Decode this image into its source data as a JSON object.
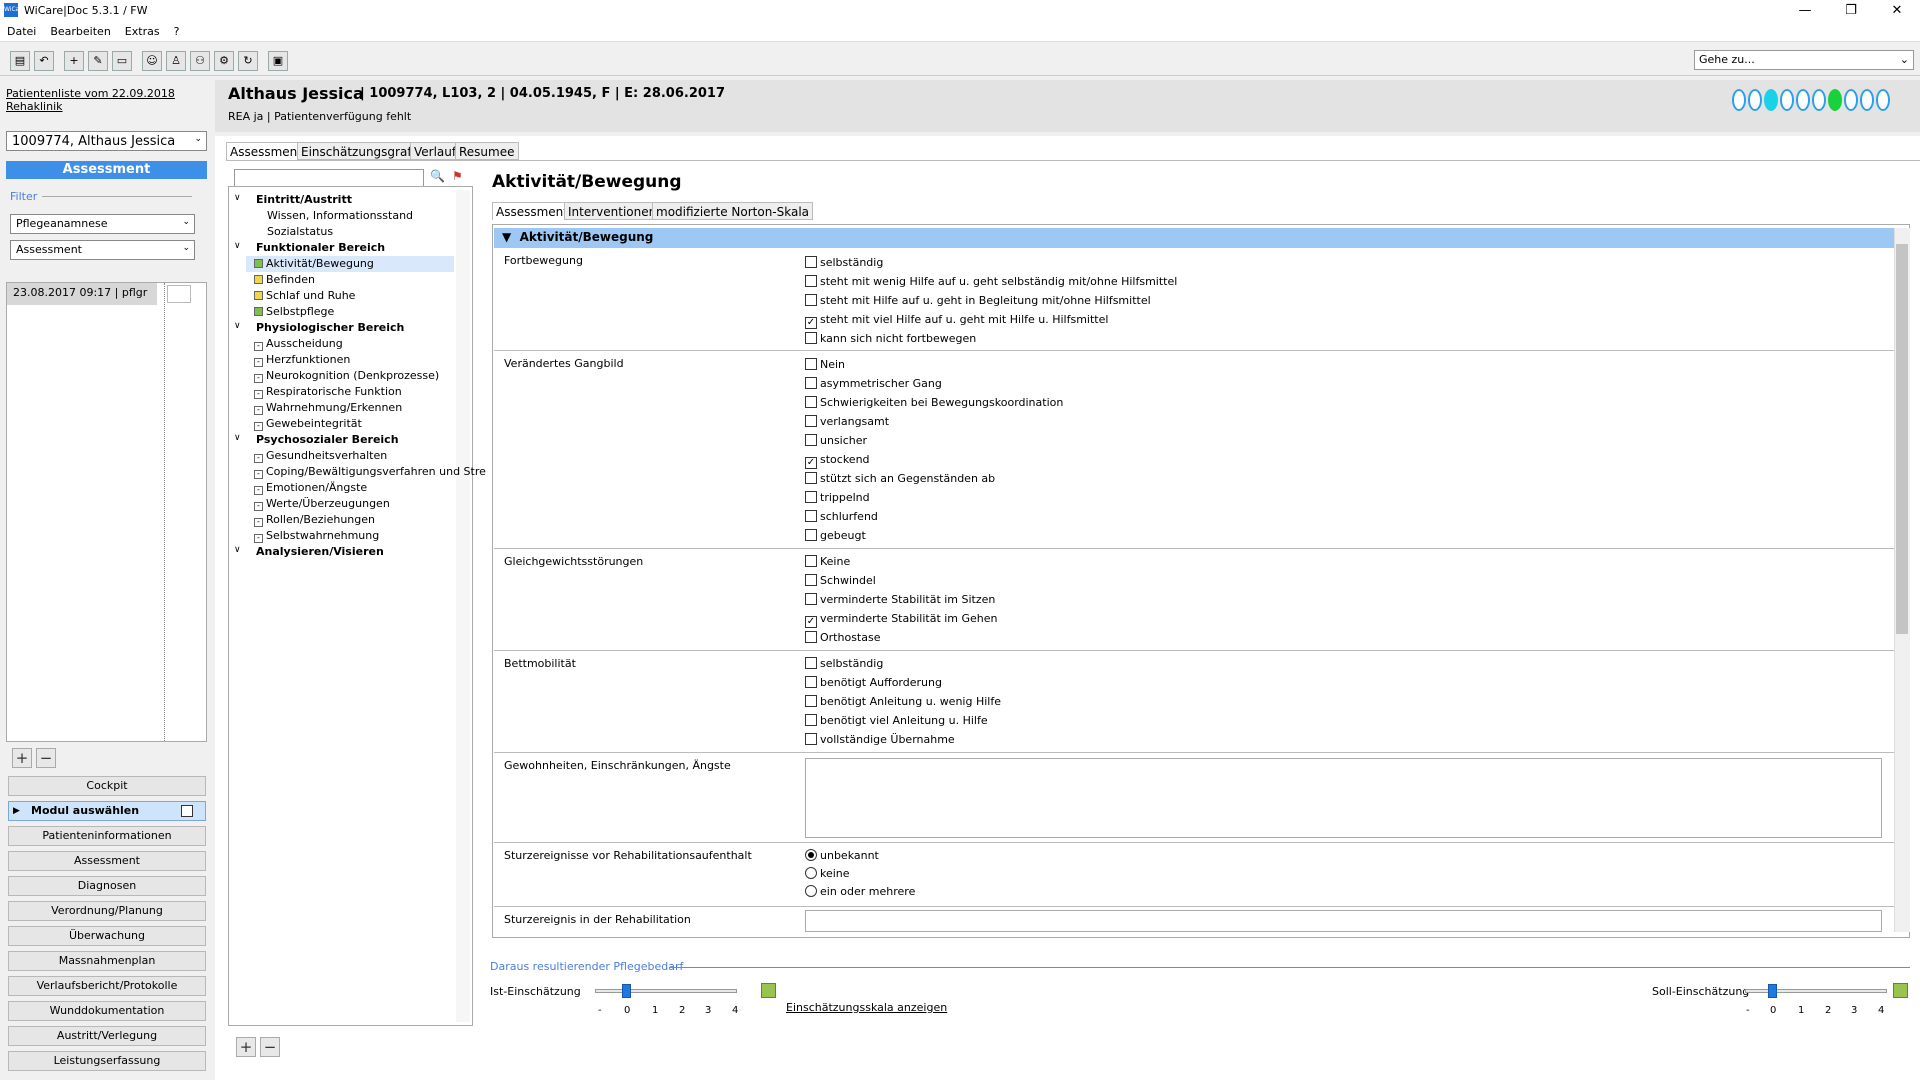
{
  "window": {
    "title": "WiCare|Doc 5.3.1  / FW",
    "icon_label": "WiCare"
  },
  "menu": [
    "Datei",
    "Bearbeiten",
    "Extras",
    "?"
  ],
  "goto": {
    "value": "Gehe zu..."
  },
  "left": {
    "patient_list": "Patientenliste vom 22.09.2018",
    "clinic": "Rehaklinik",
    "patient_select": "1009774, Althaus Jessica",
    "section_title": "Assessment",
    "filter_label": "Filter",
    "filter1": "Pflegeanamnese",
    "filter2": "Assessment",
    "entry": "23.08.2017 09:17 | pflgr",
    "nav": [
      "Cockpit",
      "Modul auswählen",
      "Patienteninformationen",
      "Assessment",
      "Diagnosen",
      "Verordnung/Planung",
      "Überwachung",
      "Massnahmenplan",
      "Verlaufsbericht/Protokolle",
      "Wunddokumentation",
      "Austritt/Verlegung",
      "Leistungserfassung"
    ]
  },
  "patient": {
    "name": "Althaus Jessica",
    "info": "| 1009774, L103, 2 | 04.05.1945, F | E: 28.06.2017",
    "sub": "REA ja | Patientenverfügung fehlt"
  },
  "tabs": [
    "Assessment",
    "Einschätzungsgrafik",
    "Verlauf",
    "Resumee"
  ],
  "tree": {
    "groups": [
      {
        "label": "Eintritt/Austritt",
        "items": [
          "Wissen, Informationsstand",
          "Sozialstatus"
        ]
      },
      {
        "label": "Funktionaler Bereich",
        "items": [
          "Aktivität/Bewegung",
          "Befinden",
          "Schlaf und Ruhe",
          "Selbstpflege"
        ]
      },
      {
        "label": "Physiologischer Bereich",
        "items": [
          "Ausscheidung",
          "Herzfunktionen",
          "Neurokognition (Denkprozesse)",
          "Respiratorische Funktion",
          "Wahrnehmung/Erkennen",
          "Gewebeintegrität"
        ]
      },
      {
        "label": "Psychosozialer Bereich",
        "items": [
          "Gesundheitsverhalten",
          "Coping/Bewältigungsverfahren und Stre",
          "Emotionen/Ängste",
          "Werte/Überzeugungen",
          "Rollen/Beziehungen",
          "Selbstwahrnehmung"
        ]
      },
      {
        "label": "Analysieren/Visieren",
        "items": []
      }
    ]
  },
  "detail": {
    "title": "Aktivität/Bewegung",
    "subtabs": [
      "Assessment",
      "Interventionen",
      "modifizierte Norton-Skala"
    ],
    "header": "Aktivität/Bewegung",
    "fortbewegung": {
      "label": "Fortbewegung",
      "options": [
        "selbständig",
        "steht mit wenig Hilfe auf u. geht selbständig mit/ohne Hilfsmittel",
        "steht mit Hilfe auf u. geht in Begleitung mit/ohne Hilfsmittel",
        "steht mit viel Hilfe auf u. geht mit Hilfe u. Hilfsmittel",
        "kann sich nicht fortbewegen"
      ],
      "checked": [
        3
      ]
    },
    "gangbild": {
      "label": "Verändertes Gangbild",
      "options": [
        "Nein",
        "asymmetrischer Gang",
        "Schwierigkeiten bei Bewegungskoordination",
        "verlangsamt",
        "unsicher",
        "stockend",
        "stützt sich an Gegenständen ab",
        "trippelnd",
        "schlurfend",
        "gebeugt"
      ],
      "checked": [
        5
      ]
    },
    "gleichgewicht": {
      "label": "Gleichgewichtsstörungen",
      "options": [
        "Keine",
        "Schwindel",
        "verminderte Stabilität im Sitzen",
        "verminderte Stabilität im Gehen",
        "Orthostase"
      ],
      "checked": [
        3
      ]
    },
    "bett": {
      "label": "Bettmobilität",
      "options": [
        "selbständig",
        "benötigt Aufforderung",
        "benötigt Anleitung u. wenig Hilfe",
        "benötigt viel Anleitung u. Hilfe",
        "vollständige Übernahme"
      ],
      "checked": []
    },
    "gewohnheiten": {
      "label": "Gewohnheiten, Einschränkungen, Ängste",
      "value": ""
    },
    "sturz_vor": {
      "label": "Sturzereignisse vor Rehabilitationsaufenthalt",
      "options": [
        "unbekannt",
        "keine",
        "ein oder mehrere"
      ],
      "selected": 0
    },
    "sturz_reha": {
      "label": "Sturzereignis in der Rehabilitation",
      "value": ""
    }
  },
  "bottom": {
    "need_label": "Daraus resultierender Pflegebedarf",
    "ist_label": "Ist-Einschätzung",
    "ist_value": 0,
    "soll_label": "Soll-Einschätzung",
    "soll_value": 0,
    "scale_link": "Einschätzungsskala anzeigen",
    "ticks": [
      "-",
      "0",
      "1",
      "2",
      "3",
      "4"
    ]
  },
  "colors": {
    "accent": "#3d8fe8",
    "header": "#9cc8f3",
    "green": "#9ac24f",
    "dot_active": "#1ad1e6",
    "dot_green": "#19d13c"
  }
}
